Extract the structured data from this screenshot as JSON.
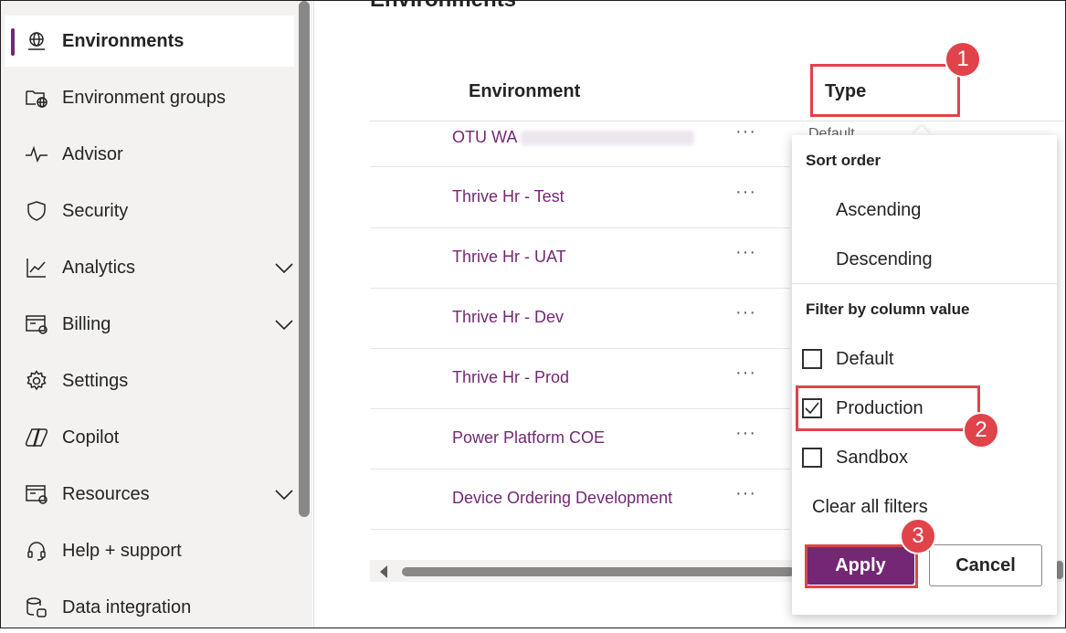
{
  "sidebar": {
    "items": [
      {
        "label": "Environments",
        "icon": "globe-icon",
        "selected": true,
        "has_chevron": false
      },
      {
        "label": "Environment groups",
        "icon": "folder-globe-icon",
        "selected": false,
        "has_chevron": false
      },
      {
        "label": "Advisor",
        "icon": "pulse-icon",
        "selected": false,
        "has_chevron": false
      },
      {
        "label": "Security",
        "icon": "shield-icon",
        "selected": false,
        "has_chevron": false
      },
      {
        "label": "Analytics",
        "icon": "chart-line-icon",
        "selected": false,
        "has_chevron": true
      },
      {
        "label": "Billing",
        "icon": "billing-icon",
        "selected": false,
        "has_chevron": true
      },
      {
        "label": "Settings",
        "icon": "gear-icon",
        "selected": false,
        "has_chevron": false
      },
      {
        "label": "Copilot",
        "icon": "copilot-icon",
        "selected": false,
        "has_chevron": false
      },
      {
        "label": "Resources",
        "icon": "resources-icon",
        "selected": false,
        "has_chevron": true
      },
      {
        "label": "Help + support",
        "icon": "headset-icon",
        "selected": false,
        "has_chevron": false
      },
      {
        "label": "Data integration",
        "icon": "data-integration-icon",
        "selected": false,
        "has_chevron": false
      }
    ]
  },
  "main": {
    "title": "Environments",
    "columns": {
      "environment": "Environment",
      "type": "Type"
    },
    "rows": [
      {
        "name": "OTU WA",
        "more": "···",
        "type": "Default"
      },
      {
        "name": "Thrive Hr - Test",
        "more": "···"
      },
      {
        "name": "Thrive Hr - UAT",
        "more": "···"
      },
      {
        "name": "Thrive Hr - Dev",
        "more": "···"
      },
      {
        "name": "Thrive Hr - Prod",
        "more": "···"
      },
      {
        "name": "Power Platform COE",
        "more": "···"
      },
      {
        "name": "Device Ordering Development",
        "more": "···"
      }
    ]
  },
  "popup": {
    "sort_header": "Sort order",
    "ascending": "Ascending",
    "descending": "Descending",
    "filter_header": "Filter by column value",
    "filters": [
      {
        "label": "Default",
        "checked": false
      },
      {
        "label": "Production",
        "checked": true
      },
      {
        "label": "Sandbox",
        "checked": false
      }
    ],
    "clear": "Clear all filters",
    "apply": "Apply",
    "cancel": "Cancel"
  },
  "annotations": {
    "step1": "1",
    "step2": "2",
    "step3": "3",
    "color": "#e0434a"
  },
  "colors": {
    "accent": "#742774",
    "sidebar_bg": "#f3f2f1",
    "link": "#742774"
  }
}
